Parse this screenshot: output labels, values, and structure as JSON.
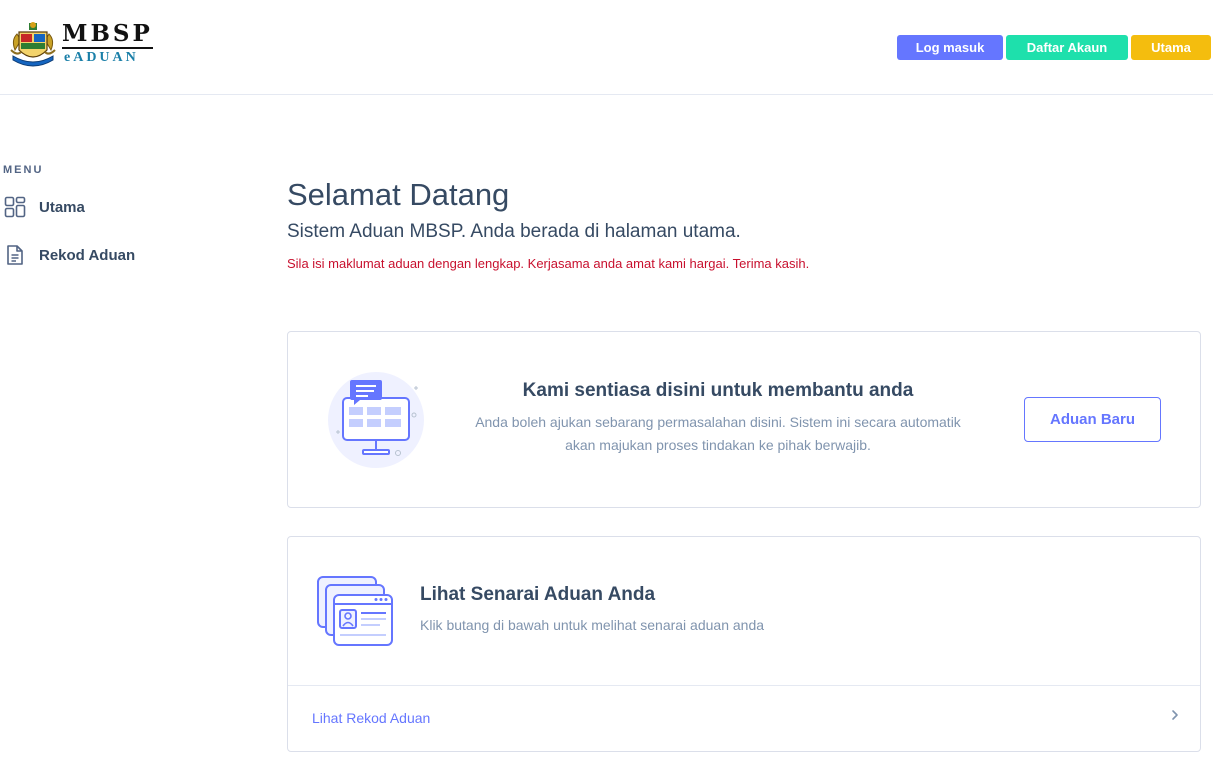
{
  "header": {
    "logo_title": "MBSP",
    "logo_subtitle": "eADUAN",
    "buttons": {
      "login": "Log masuk",
      "register": "Daftar Akaun",
      "home": "Utama"
    }
  },
  "sidebar": {
    "title": "MENU",
    "items": [
      {
        "label": "Utama",
        "icon": "grid-icon"
      },
      {
        "label": "Rekod Aduan",
        "icon": "document-icon"
      }
    ]
  },
  "main": {
    "title": "Selamat Datang",
    "subtitle": "Sistem Aduan MBSP. Anda berada di halaman utama.",
    "notice": "Sila isi maklumat aduan dengan lengkap. Kerjasama anda amat kami hargai. Terima kasih."
  },
  "card_help": {
    "heading": "Kami sentiasa disini untuk membantu anda",
    "text": "Anda boleh ajukan sebarang permasalahan disini. Sistem ini secara automatik akan majukan proses tindakan ke pihak berwajib.",
    "button": "Aduan Baru"
  },
  "card_list": {
    "heading": "Lihat Senarai Aduan Anda",
    "text": "Klik butang di bawah untuk melihat senarai aduan anda",
    "link": "Lihat Rekod Aduan"
  },
  "colors": {
    "primary": "#6576ff",
    "success": "#1ee0ac",
    "warning": "#f4bd0e",
    "danger_text": "#c8102e",
    "heading": "#364a63",
    "muted": "#8094ae"
  }
}
